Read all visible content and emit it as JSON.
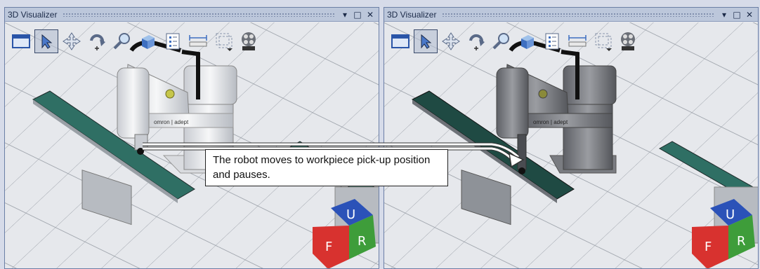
{
  "panels": [
    {
      "title": "3D Visualizer"
    },
    {
      "title": "3D Visualizer"
    }
  ],
  "window_buttons": {
    "dropdown": "▾",
    "maximize": "□",
    "close": "✕"
  },
  "toolbar_icons": [
    "view-window-icon",
    "select-arrow-icon",
    "pan-move-icon",
    "rotate-icon",
    "zoom-icon",
    "3d-object-icon",
    "edit-properties-icon",
    "measure-icon",
    "view-cube-dropdown-icon",
    "record-film-icon"
  ],
  "callout": {
    "text": "The robot moves to workpiece pick-up position and pauses."
  },
  "nav_cube": {
    "top": "U",
    "left": "F",
    "right": "R"
  },
  "robot": {
    "brand": "omron | adept"
  },
  "colors": {
    "conveyor_belt": "#2f6f64",
    "cube_top": "#2b52b8",
    "cube_left": "#d8322f",
    "cube_right": "#3e9d3a",
    "highlight_robot_dim": "#6e6e6e"
  }
}
